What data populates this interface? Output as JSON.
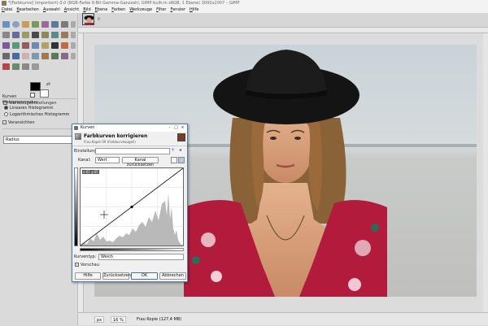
{
  "window": {
    "title": "*[Farbkurve] (importiert)-3.0 (RGB-Farbe 8-Bit Gamma-Ganzzahl, GIMP built-in sRGB, 1 Ebene) 3000x2007 – GIMP"
  },
  "menubar": [
    "Datei",
    "Bearbeiten",
    "Auswahl",
    "Ansicht",
    "Bild",
    "Ebene",
    "Farben",
    "Werkzeuge",
    "Filter",
    "Fenster",
    "Hilfe"
  ],
  "toolbox": {
    "panel_title": "Werkzeugeinstellungen",
    "section": "Kurven",
    "hist_mode_label": "Histogrammodus",
    "radio_linear": "Lineares Histogramm",
    "radio_log": "Logarithmisches Histogramm",
    "check_label": "Voransichten",
    "radius_label": "Radius"
  },
  "statusbar": {
    "unit": "px",
    "zoom": "16 %",
    "info": "Frau Kopie (127,4 MB)"
  },
  "dialog": {
    "window_title": "Kurven",
    "heading": "Farbkurven korrigieren",
    "subheading": "Frau Kopie-59 (Farbkurveaugeli)",
    "presets_label": "Einstellungen:",
    "channel_label": "Kanal:",
    "channel_value": "Wert",
    "reset_channel": "Kanal zurücksetzen",
    "coord_readout": "x:61 y:65",
    "curve_type_label": "Kurventyp:",
    "curve_type_value": "Weich",
    "preview_label": "Vorschau",
    "buttons": {
      "help": "Hilfe",
      "reset": "Zurücksetzen",
      "ok": "OK",
      "cancel": "Abbrechen"
    }
  },
  "colors": {
    "accent": "#4a6fa5",
    "hat": "#141414",
    "dress": "#b21b3c"
  }
}
